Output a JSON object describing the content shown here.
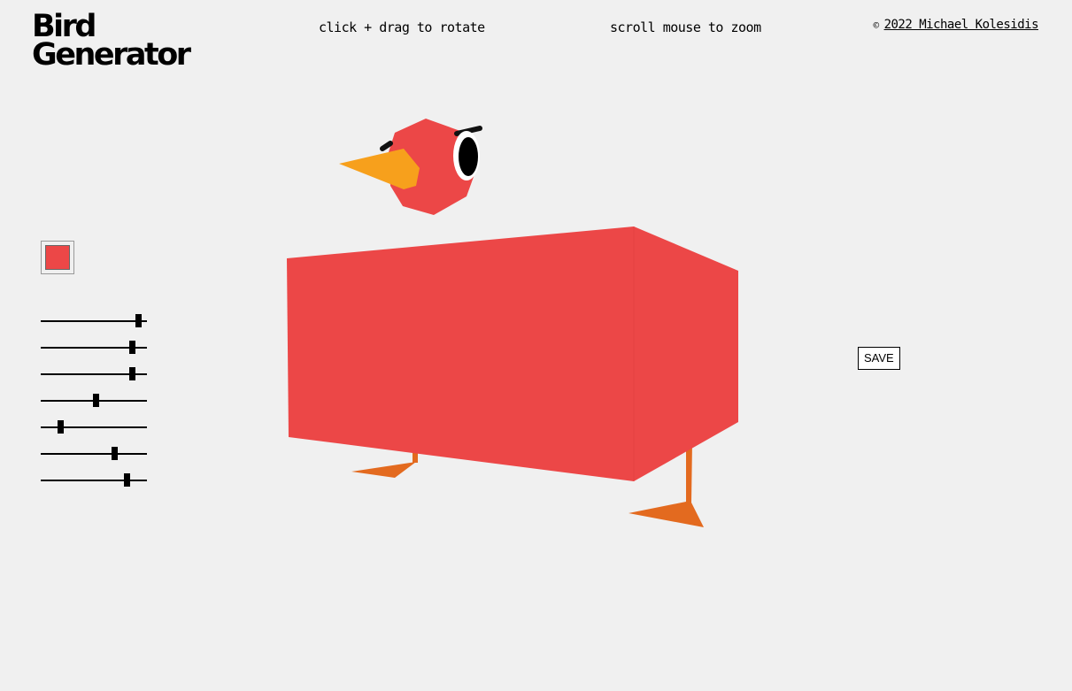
{
  "header": {
    "title_line1": "Bird",
    "title_line2": "Generator",
    "hint_rotate": "click + drag to rotate",
    "hint_zoom": "scroll mouse to zoom",
    "credit_symbol": "©",
    "credit_link": "2022 Michael Kolesidis"
  },
  "controls": {
    "body_color": "#ec4747",
    "sliders": [
      {
        "value": 0.92
      },
      {
        "value": 0.86
      },
      {
        "value": 0.86
      },
      {
        "value": 0.52
      },
      {
        "value": 0.18
      },
      {
        "value": 0.69
      },
      {
        "value": 0.81
      }
    ],
    "save_label": "SAVE"
  },
  "bird": {
    "body_color": "#ec4747",
    "beak_color": "#f7a01c",
    "leg_color": "#e36a1f",
    "eye_color": "#000000"
  }
}
